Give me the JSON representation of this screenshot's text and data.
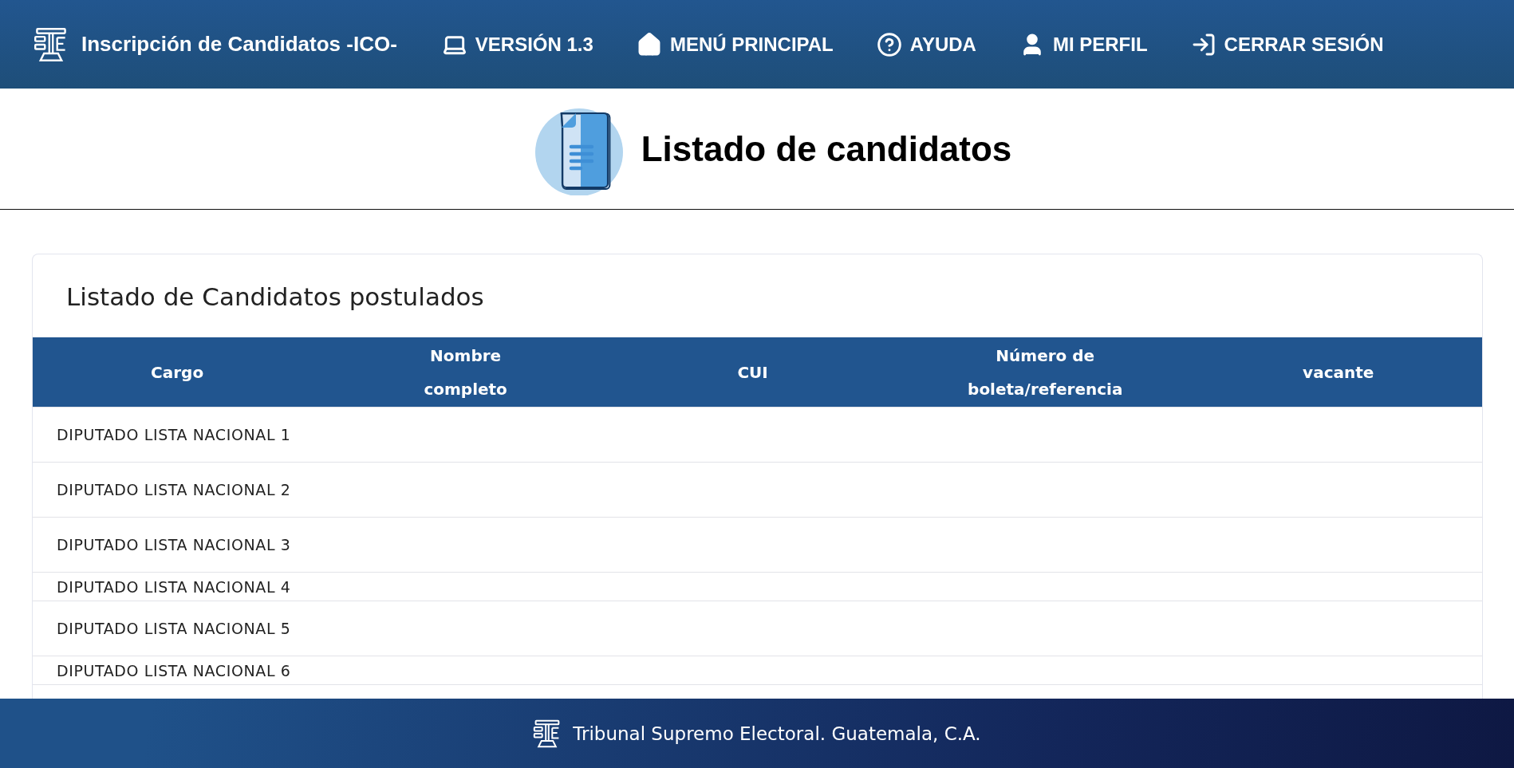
{
  "header": {
    "title": "Inscripción de Candidatos -ICO-",
    "nav": [
      {
        "kind": "laptop",
        "label": "VERSIÓN 1.3"
      },
      {
        "kind": "home",
        "label": "MENÚ PRINCIPAL"
      },
      {
        "kind": "help",
        "label": "AYUDA"
      },
      {
        "kind": "user",
        "label": "MI PERFIL"
      },
      {
        "kind": "logout",
        "label": "CERRAR SESIÓN"
      }
    ]
  },
  "page_title": "Listado de candidatos",
  "card": {
    "title": "Listado de Candidatos postulados",
    "table": {
      "columns": [
        "Cargo",
        "Nombre completo",
        "CUI",
        "Número de boleta/referencia",
        "vacante"
      ],
      "rows": [
        {
          "cargo": "DIPUTADO LISTA NACIONAL 1"
        },
        {
          "cargo": "DIPUTADO LISTA NACIONAL 2"
        },
        {
          "cargo": "DIPUTADO LISTA NACIONAL 3"
        },
        {
          "cargo": "DIPUTADO LISTA NACIONAL 4"
        },
        {
          "cargo": "DIPUTADO LISTA NACIONAL 5"
        },
        {
          "cargo": "DIPUTADO LISTA NACIONAL 6"
        }
      ]
    }
  },
  "footer": {
    "text": "Tribunal Supremo Electoral. Guatemala, C.A."
  }
}
